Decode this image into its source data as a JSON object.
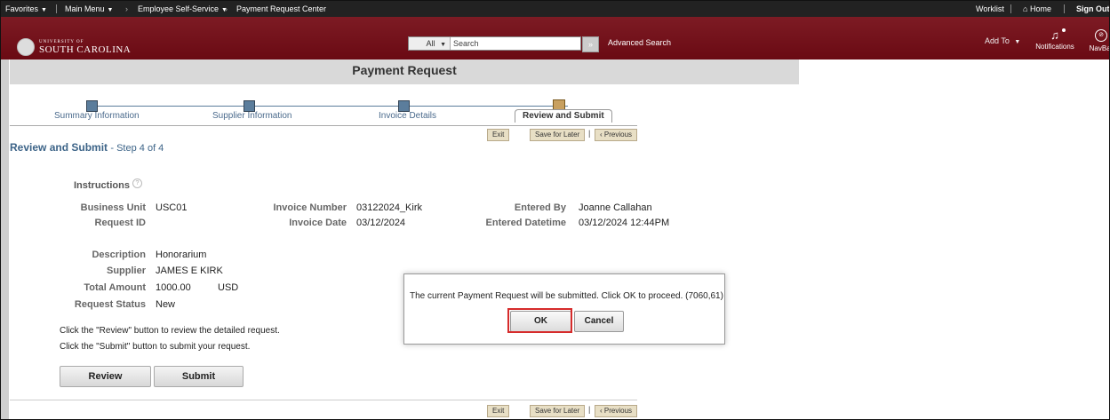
{
  "topnav": {
    "favorites": "Favorites",
    "main_menu": "Main Menu",
    "crumb1": "Employee Self-Service",
    "crumb2": "Payment Request Center",
    "worklist": "Worklist",
    "home": "Home",
    "signout": "Sign Out"
  },
  "header": {
    "logo_small": "UNIVERSITY OF",
    "logo_big": "SOUTH CAROLINA",
    "search_scope": "All",
    "search_placeholder": "Search",
    "advanced_search": "Advanced Search",
    "add_to": "Add To",
    "notifications": "Notifications",
    "navbar": "NavBar"
  },
  "page": {
    "title": "Payment Request",
    "steps": [
      {
        "label": "Summary Information"
      },
      {
        "label": "Supplier Information"
      },
      {
        "label": "Invoice Details"
      },
      {
        "label": "Review and Submit"
      }
    ],
    "step_title": "Review and Submit",
    "step_suffix": "- Step 4 of 4",
    "actions": {
      "exit": "Exit",
      "save": "Save for Later",
      "previous": "Previous"
    },
    "instructions": "Instructions"
  },
  "fields": {
    "business_unit": {
      "label": "Business Unit",
      "value": "USC01"
    },
    "request_id": {
      "label": "Request ID",
      "value": ""
    },
    "invoice_number": {
      "label": "Invoice Number",
      "value": "03122024_Kirk"
    },
    "invoice_date": {
      "label": "Invoice Date",
      "value": "03/12/2024"
    },
    "entered_by": {
      "label": "Entered By",
      "value": "Joanne Callahan"
    },
    "entered_datetime": {
      "label": "Entered Datetime",
      "value": "03/12/2024 12:44PM"
    },
    "description": {
      "label": "Description",
      "value": "Honorarium"
    },
    "supplier": {
      "label": "Supplier",
      "value": "JAMES E KIRK"
    },
    "total_amount": {
      "label": "Total Amount",
      "value": "1000.00",
      "currency": "USD"
    },
    "request_status": {
      "label": "Request Status",
      "value": "New"
    }
  },
  "notes": {
    "review": "Click the \"Review\" button to review the detailed request.",
    "submit": "Click the \"Submit\" button to submit your request."
  },
  "buttons": {
    "review": "Review",
    "submit": "Submit"
  },
  "modal": {
    "message": "The current Payment Request will be submitted. Click OK to proceed. (7060,61)",
    "ok": "OK",
    "cancel": "Cancel",
    "highlight_color": "#d62b2b"
  },
  "colors": {
    "brand": "#73000a",
    "link": "#3d6488"
  }
}
